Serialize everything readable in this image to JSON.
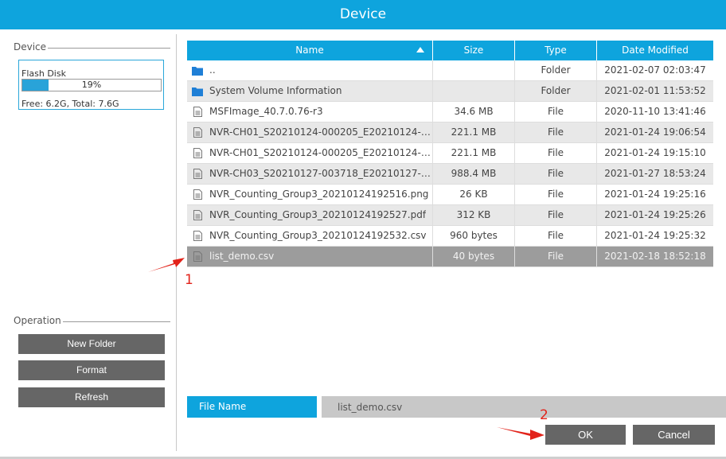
{
  "window": {
    "title": "Device"
  },
  "device_group": {
    "title": "Device",
    "disk": {
      "name": "Flash Disk",
      "usage_percent": 19,
      "usage_label": "19%",
      "free_total": "Free: 6.2G, Total: 7.6G"
    }
  },
  "operation_group": {
    "title": "Operation",
    "buttons": {
      "new_folder": "New Folder",
      "format": "Format",
      "refresh": "Refresh"
    }
  },
  "table": {
    "columns": {
      "name": "Name",
      "size": "Size",
      "type": "Type",
      "date": "Date Modified"
    },
    "sort": {
      "column": "Name",
      "direction": "ascending"
    },
    "rows": [
      {
        "icon": "folder-icon",
        "name": "..",
        "size": "",
        "type": "Folder",
        "date": "2021-02-07 02:03:47"
      },
      {
        "icon": "folder-icon",
        "name": "System Volume Information",
        "size": "",
        "type": "Folder",
        "date": "2021-02-01 11:53:52"
      },
      {
        "icon": "file-icon",
        "name": "MSFImage_40.7.0.76-r3",
        "size": "34.6 MB",
        "type": "File",
        "date": "2020-11-10 13:41:46"
      },
      {
        "icon": "file-icon",
        "name": "NVR-CH01_S20210124-000205_E20210124-00...",
        "size": "221.1 MB",
        "type": "File",
        "date": "2021-01-24 19:06:54"
      },
      {
        "icon": "file-icon",
        "name": "NVR-CH01_S20210124-000205_E20210124-00...",
        "size": "221.1 MB",
        "type": "File",
        "date": "2021-01-24 19:15:10"
      },
      {
        "icon": "file-icon",
        "name": "NVR-CH03_S20210127-003718_E20210127-01...",
        "size": "988.4 MB",
        "type": "File",
        "date": "2021-01-27 18:53:24"
      },
      {
        "icon": "file-icon",
        "name": "NVR_Counting_Group3_20210124192516.png",
        "size": "26 KB",
        "type": "File",
        "date": "2021-01-24 19:25:16"
      },
      {
        "icon": "file-icon",
        "name": "NVR_Counting_Group3_20210124192527.pdf",
        "size": "312 KB",
        "type": "File",
        "date": "2021-01-24 19:25:26"
      },
      {
        "icon": "file-icon",
        "name": "NVR_Counting_Group3_20210124192532.csv",
        "size": "960 bytes",
        "type": "File",
        "date": "2021-01-24 19:25:32"
      },
      {
        "icon": "file-icon",
        "name": "list_demo.csv",
        "size": "40 bytes",
        "type": "File",
        "date": "2021-02-18 18:52:18",
        "selected": true
      }
    ]
  },
  "file_name": {
    "label": "File Name",
    "value": "list_demo.csv"
  },
  "actions": {
    "ok": "OK",
    "cancel": "Cancel"
  },
  "annotations": {
    "step1": "1",
    "step2": "2",
    "color": "#e2231a"
  },
  "colors": {
    "accent": "#0ea4dd",
    "button": "#666666",
    "selected_row": "#9c9c9c"
  }
}
